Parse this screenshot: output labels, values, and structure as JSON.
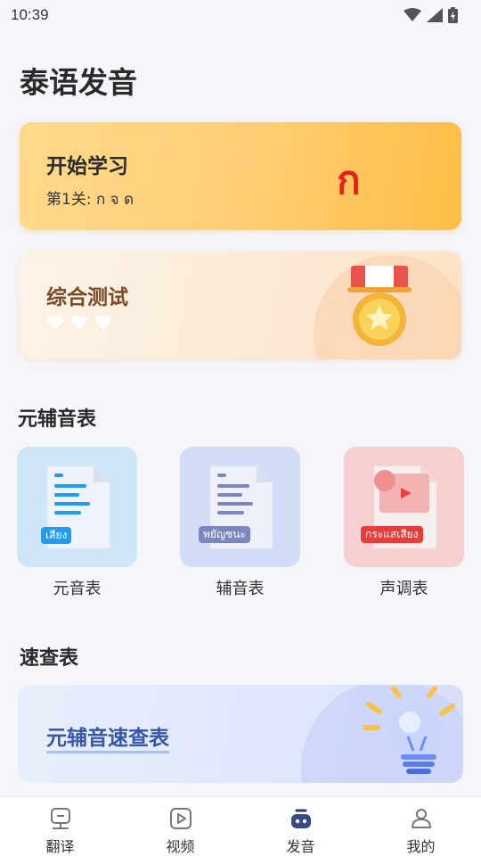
{
  "status": {
    "time": "10:39"
  },
  "page": {
    "title": "泰语发音"
  },
  "start_card": {
    "title": "开始学习",
    "subtitle": "第1关: ก จ ด",
    "glyph": "ก"
  },
  "test_card": {
    "title": "综合测试",
    "hearts": 3
  },
  "sections": {
    "tables": "元辅音表",
    "quick": "速查表"
  },
  "tiles": [
    {
      "label": "元音表",
      "tag": "เสียง",
      "color": "#cfe5f8"
    },
    {
      "label": "辅音表",
      "tag": "พยัญชนะ",
      "color": "#d3ddf8"
    },
    {
      "label": "声调表",
      "tag": "กระแสเสียง",
      "color": "#f6d0d0"
    }
  ],
  "quick_card": {
    "title": "元辅音速查表"
  },
  "tabs": [
    {
      "label": "翻译",
      "icon": "translate-icon",
      "active": false
    },
    {
      "label": "视频",
      "icon": "video-icon",
      "active": false
    },
    {
      "label": "发音",
      "icon": "pronunciation-icon",
      "active": true
    },
    {
      "label": "我的",
      "icon": "profile-icon",
      "active": false
    }
  ],
  "colors": {
    "accent_orange": "#ffbd45",
    "thai_red": "#ee1c1c",
    "quick_blue": "#3656a8"
  }
}
